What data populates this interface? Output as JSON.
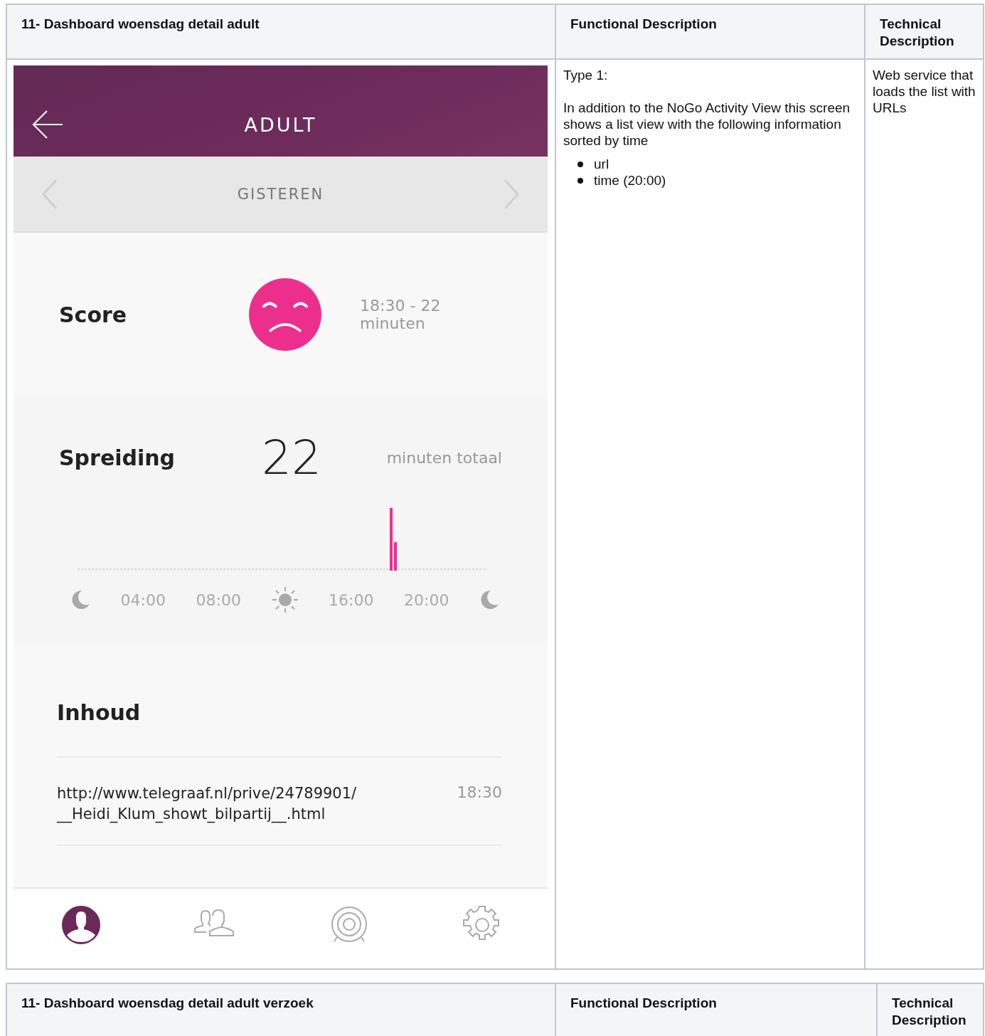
{
  "tables": [
    {
      "headers": [
        "11- Dashboard woensdag detail adult",
        "Functional Description",
        "Technical Description"
      ],
      "app": {
        "title": "ADULT",
        "day": "GISTEREN",
        "score": {
          "label": "Score",
          "detail": "18:30 - 22 minuten"
        },
        "spread": {
          "label": "Spreiding",
          "value": "22",
          "unit": "minuten totaal",
          "axis": [
            {
              "kind": "moon"
            },
            {
              "kind": "text",
              "label": "04:00"
            },
            {
              "kind": "text",
              "label": "08:00"
            },
            {
              "kind": "sun"
            },
            {
              "kind": "text",
              "label": "16:00"
            },
            {
              "kind": "text",
              "label": "20:00"
            },
            {
              "kind": "moon"
            }
          ]
        },
        "content": {
          "label": "Inhoud",
          "items": [
            {
              "url": "http://www.telegraaf.nl/prive/24789901/\n__Heidi_Klum_showt_bilpartij__.html",
              "time": "18:30"
            }
          ]
        },
        "nav": [
          {
            "kind": "person",
            "selected": true
          },
          {
            "kind": "people",
            "selected": false
          },
          {
            "kind": "target",
            "selected": false
          },
          {
            "kind": "gear",
            "selected": false
          }
        ]
      },
      "functional": {
        "type": "Type 1:",
        "text": "In addition to the NoGo Activity View this screen shows a list view with the following information sorted by time",
        "bullets": [
          "url",
          "time (20:00)"
        ]
      },
      "technical": "Web service that loads the list with URLs"
    },
    {
      "headers": [
        "11- Dashboard woensdag detail adult verzoek",
        "Functional Description",
        "Technical Description"
      ]
    }
  ]
}
